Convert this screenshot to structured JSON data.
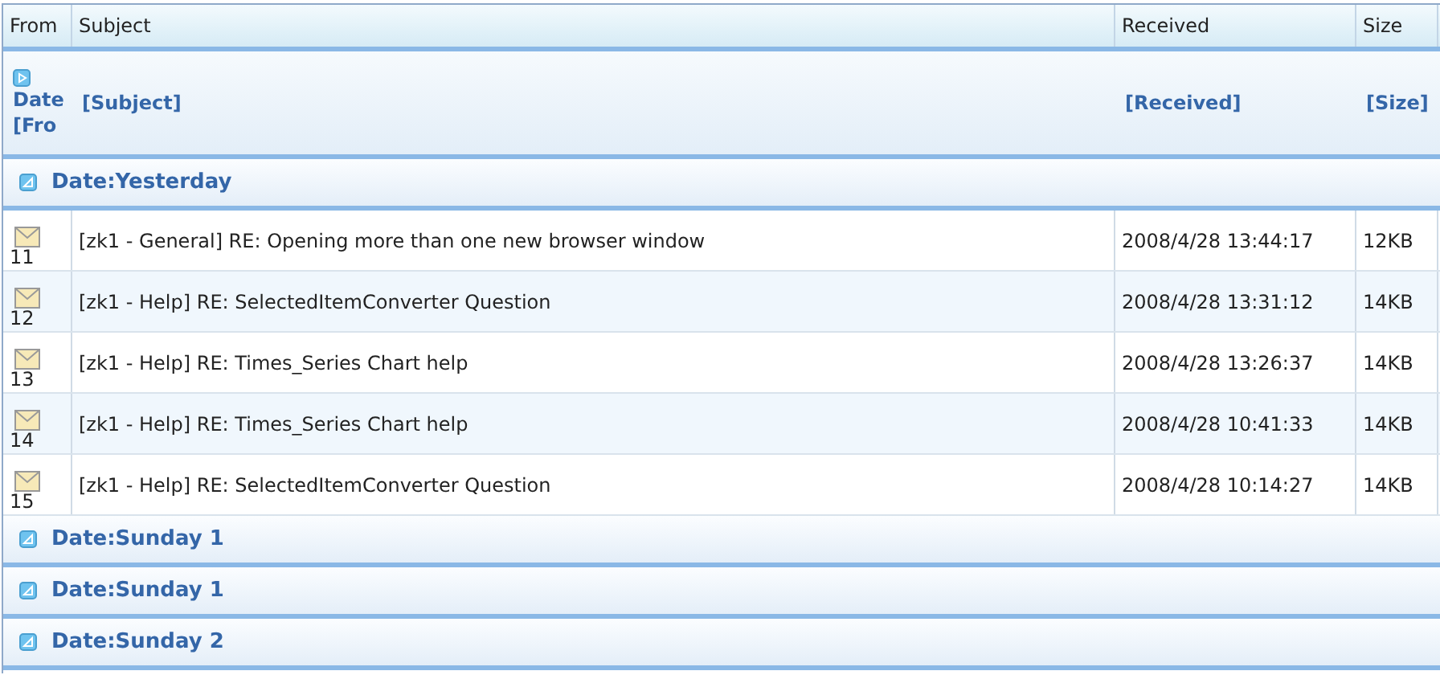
{
  "columns": [
    "From",
    "Subject",
    "Received",
    "Size"
  ],
  "summary": {
    "from_lines": [
      "Date",
      "[Fro"
    ],
    "subject": "[Subject]",
    "received": "[Received]",
    "size": "[Size]"
  },
  "groups": [
    {
      "label": "Date:Yesterday",
      "rows": [
        {
          "from": "11",
          "subject": "[zk1 - General] RE: Opening more than one new browser window",
          "received": "2008/4/28 13:44:17",
          "size": "12KB"
        },
        {
          "from": "12",
          "subject": "[zk1 - Help] RE: SelectedItemConverter Question",
          "received": "2008/4/28 13:31:12",
          "size": "14KB"
        },
        {
          "from": "13",
          "subject": "[zk1 - Help] RE: Times_Series Chart help",
          "received": "2008/4/28 13:26:37",
          "size": "14KB"
        },
        {
          "from": "14",
          "subject": "[zk1 - Help] RE: Times_Series Chart help",
          "received": "2008/4/28 10:41:33",
          "size": "14KB"
        },
        {
          "from": "15",
          "subject": "[zk1 - Help] RE: SelectedItemConverter Question",
          "received": "2008/4/28 10:14:27",
          "size": "14KB"
        }
      ]
    },
    {
      "label": "Date:Sunday 1"
    },
    {
      "label": "Date:Sunday 1"
    },
    {
      "label": "Date:Sunday 2"
    }
  ]
}
